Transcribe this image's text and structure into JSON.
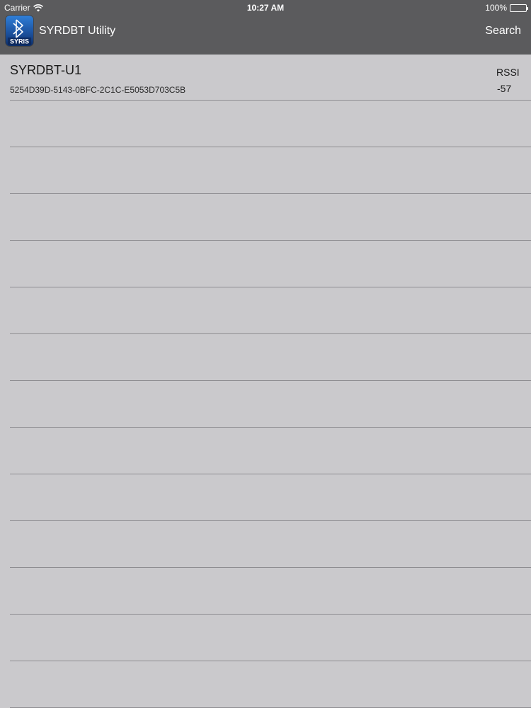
{
  "status_bar": {
    "carrier": "Carrier",
    "time": "10:27 AM",
    "battery": "100%"
  },
  "nav": {
    "app_title": "SYRDBT Utility",
    "search_label": "Search",
    "icon_text": "SYRIS"
  },
  "devices": [
    {
      "name": "SYRDBT-U1",
      "uuid": "5254D39D-5143-0BFC-2C1C-E5053D703C5B",
      "rssi_label": "RSSI",
      "rssi_value": "-57"
    }
  ],
  "empty_rows": 13,
  "colors": {
    "nav_background": "#5b5b5d",
    "list_background": "#cac9cc",
    "separator": "#8e8d91",
    "icon_blue": "#1b4f9b"
  },
  "icons": {
    "wifi": "wifi-icon",
    "battery": "battery-icon",
    "bluetooth": "bluetooth-icon"
  }
}
